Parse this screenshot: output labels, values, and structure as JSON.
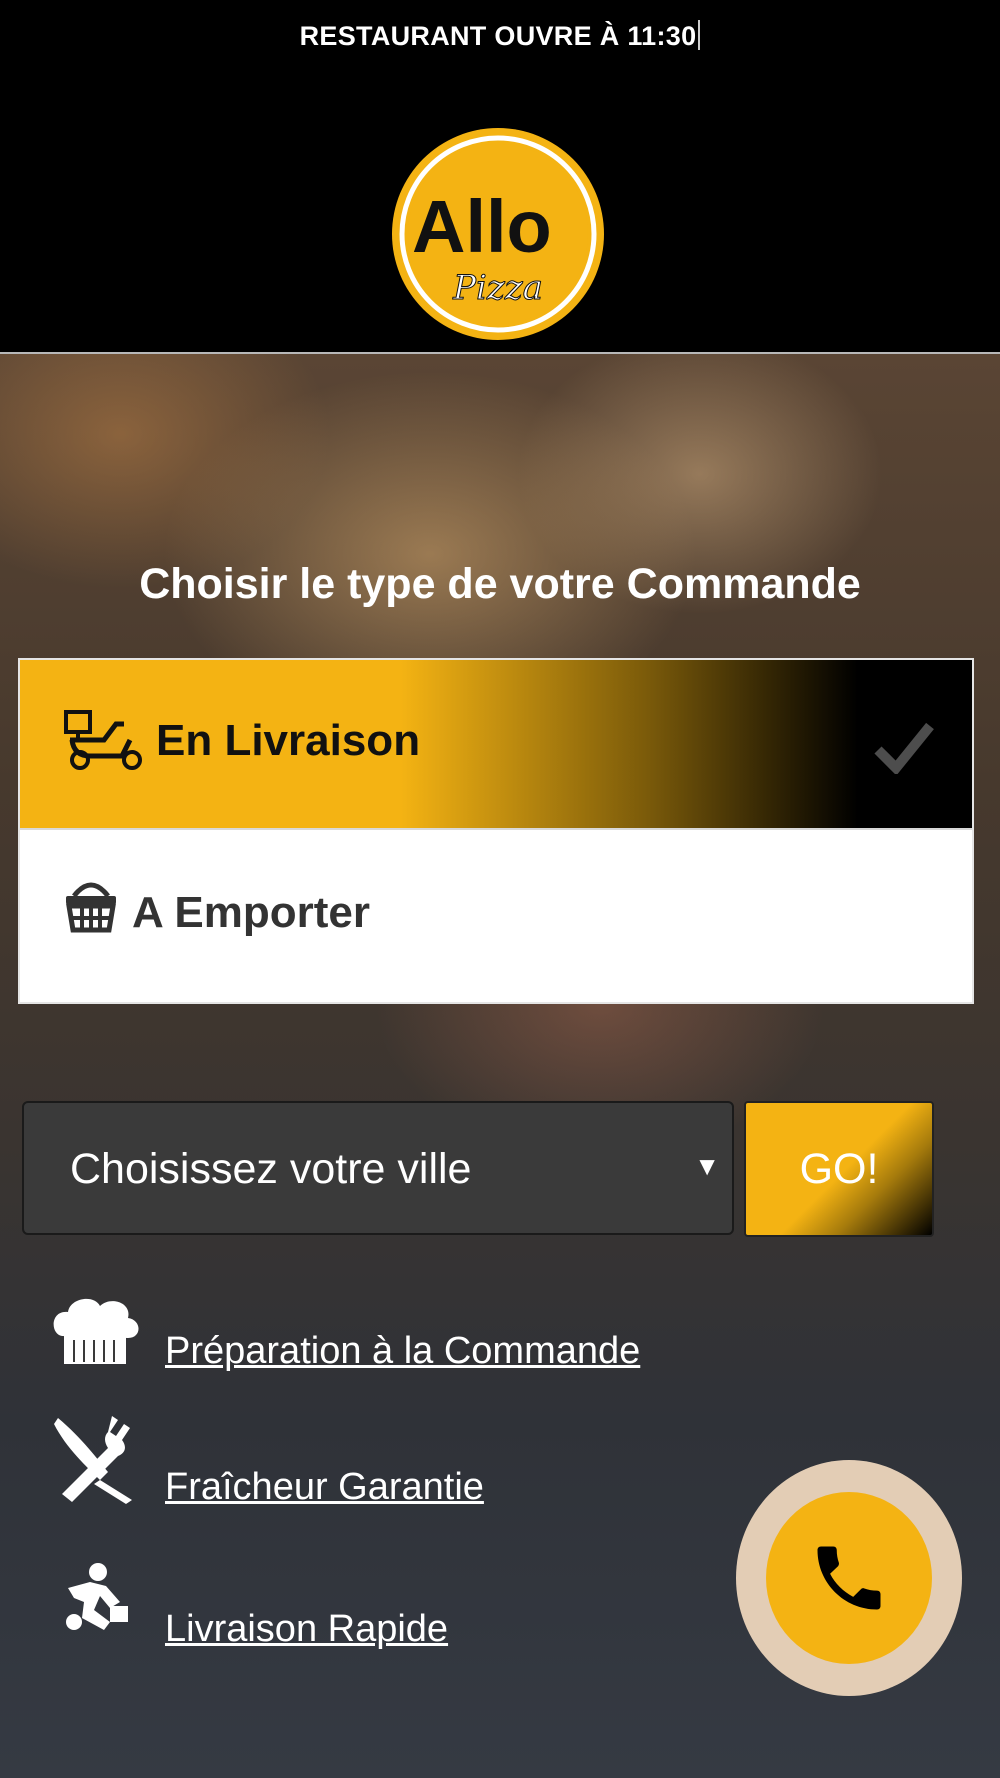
{
  "header": {
    "announcement": "RESTAURANT OUVRE À 11:30",
    "logo": {
      "main_text": "Allo",
      "sub_text": "Pizza",
      "colors": {
        "ring": "#f4b313",
        "text": "#111111"
      }
    }
  },
  "main": {
    "title": "Choisir le type de votre Commande",
    "order_options": [
      {
        "label": "En Livraison",
        "icon": "scooter-delivery-icon",
        "selected": true
      },
      {
        "label": "A Emporter",
        "icon": "basket-icon",
        "selected": false
      }
    ],
    "city_select": {
      "value": "Choisissez votre ville",
      "arrow": "▼"
    },
    "go_button": {
      "label": "GO!"
    },
    "features": [
      {
        "label": "Préparation à la Commande",
        "icon": "chef-hat-icon"
      },
      {
        "label": "Fraîcheur Garantie",
        "icon": "fork-knife-icon"
      },
      {
        "label": "Livraison Rapide",
        "icon": "delivery-runner-icon"
      }
    ],
    "call_button": {
      "icon": "phone-icon"
    }
  },
  "colors": {
    "accent": "#f4b313",
    "header_bg": "#000000",
    "call_ring": "#e3cdb5"
  }
}
